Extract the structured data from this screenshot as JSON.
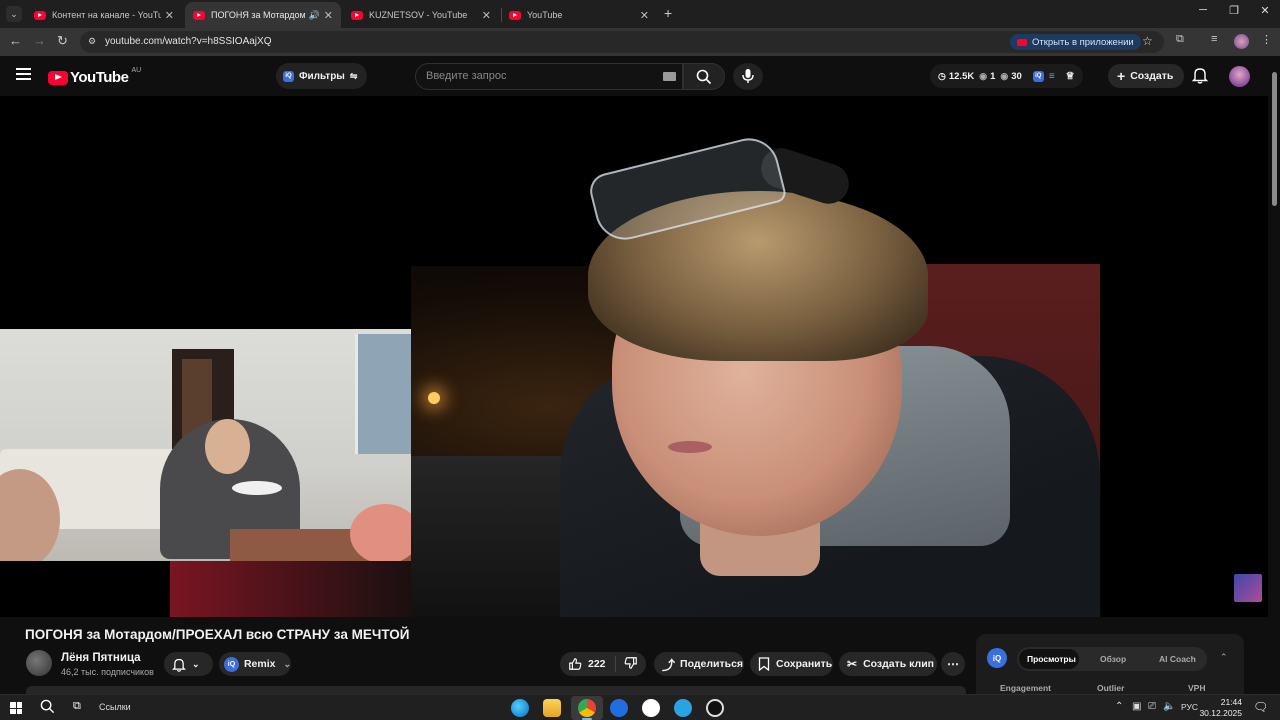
{
  "browser": {
    "tabs": [
      {
        "title": "Контент на канале - YouTube S",
        "active": false
      },
      {
        "title": "ПОГОНЯ за Мотардом/ПРО",
        "active": true
      },
      {
        "title": "KUZNETSOV - YouTube",
        "active": false
      },
      {
        "title": "YouTube",
        "active": false
      }
    ],
    "url": "youtube.com/watch?v=h8SSIOAajXQ",
    "open_in_app": "Открыть в приложении"
  },
  "youtube": {
    "logo_text": "YouTube",
    "region": "AU",
    "filters_label": "Фильтры",
    "search_placeholder": "Введите запрос",
    "stats": {
      "views": "12.5K",
      "viewers": "1",
      "count": "30"
    },
    "create_label": "Создать"
  },
  "video": {
    "title": "ПОГОНЯ за Мотардом/ПРОЕХАЛ всю СТРАНУ за МЕЧТОЙ",
    "channel_name": "Лёня Пятница",
    "subscribers": "46,2 тыс. подписчиков",
    "remix_label": "Remix",
    "likes": "222",
    "share_label": "Поделиться",
    "save_label": "Сохранить",
    "clip_label": "Создать клип"
  },
  "sidepanel": {
    "tabs": [
      "Просмотры",
      "Обзор",
      "AI Coach"
    ],
    "columns": [
      "Engagement",
      "Outlier",
      "VPH"
    ]
  },
  "taskbar": {
    "links_label": "Ссылки",
    "language": "РУС",
    "time": "21:44",
    "date": "30.12.2025"
  },
  "colors": {
    "accent": "#ff0033",
    "background": "#0f0f0f",
    "iq_blue": "#3b6fe0"
  }
}
